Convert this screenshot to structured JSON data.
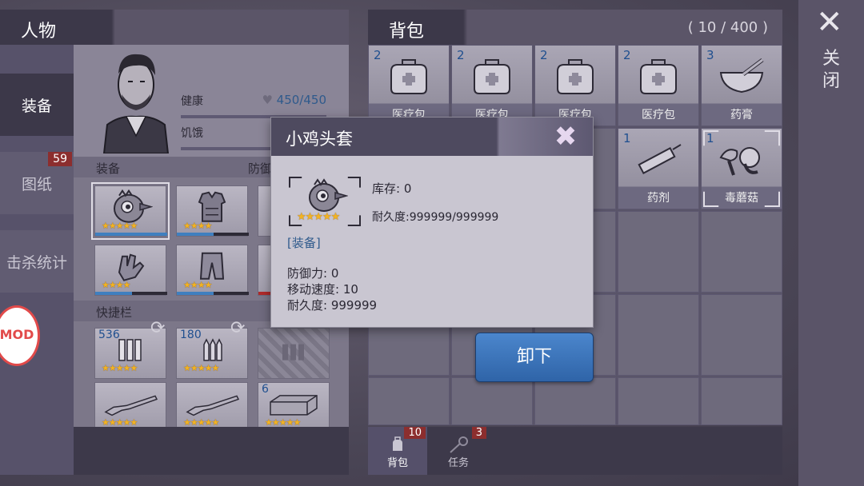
{
  "character": {
    "title": "人物",
    "tabs": [
      {
        "label": "装备",
        "badge": ""
      },
      {
        "label": "图纸",
        "badge": "59"
      },
      {
        "label": "击杀统计",
        "badge": ""
      }
    ],
    "stats": {
      "health_label": "健康",
      "health_value": "450/450",
      "hunger_label": "饥饿"
    },
    "equipment_label": "装备",
    "defense_label": "防御",
    "quickbar_label": "快捷栏",
    "quickbar_counts": [
      "536",
      "180",
      "6"
    ]
  },
  "backpack": {
    "title": "背包",
    "count": "( 10 / 400 )",
    "items": [
      {
        "count": "2",
        "name": "医疗包"
      },
      {
        "count": "2",
        "name": "医疗包"
      },
      {
        "count": "2",
        "name": "医疗包"
      },
      {
        "count": "2",
        "name": "医疗包"
      },
      {
        "count": "3",
        "name": "药膏"
      },
      {
        "count": "1",
        "name": "药剂"
      },
      {
        "count": "1",
        "name": "毒蘑菇"
      }
    ],
    "footer_tabs": [
      {
        "label": "背包",
        "badge": "10"
      },
      {
        "label": "任务",
        "badge": "3"
      }
    ]
  },
  "close": {
    "label": "关闭"
  },
  "mod_badge": "MOD",
  "modal": {
    "title": "小鸡头套",
    "stock": "库存: 0",
    "durability_line": "耐久度:999999/999999",
    "tag": "[装备]",
    "defense": "防御力: 0",
    "speed": "移动速度: 10",
    "durability": "耐久度: 999999",
    "stars": "★★★★★"
  },
  "unequip_button": "卸下",
  "star_text": {
    "five": "★★★★★",
    "four": "★★★★"
  },
  "colors": {
    "accent_blue": "#2f64a8",
    "star_gold": "#f3b321",
    "badge_red": "#8c2e2e"
  }
}
